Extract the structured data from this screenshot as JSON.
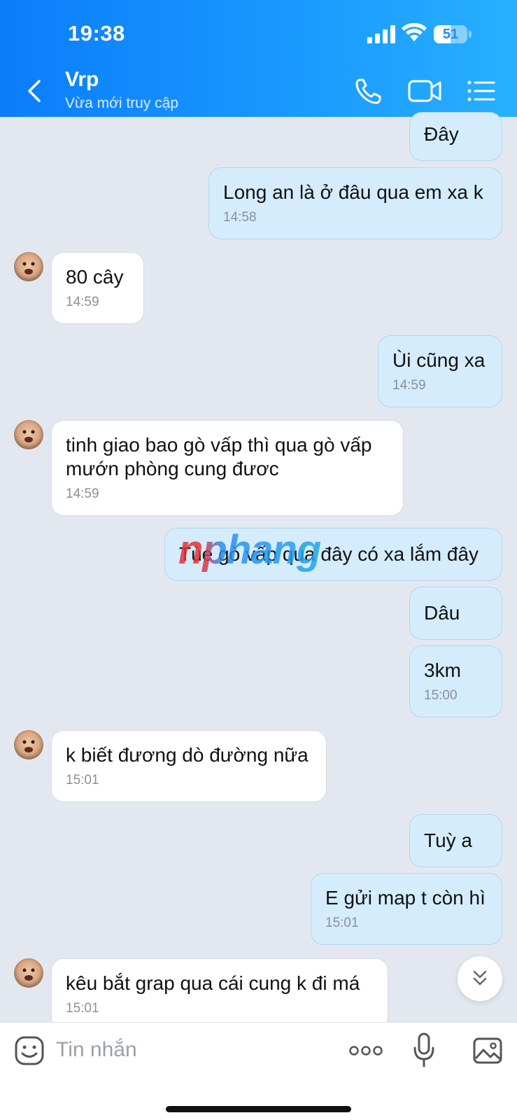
{
  "status_bar": {
    "time": "19:38",
    "battery": "51",
    "battery_level": 0.51
  },
  "header": {
    "contact_name": "Vrp",
    "contact_status": "Vừa mới truy cập"
  },
  "messages": [
    {
      "dir": "sent",
      "text": "Đây",
      "time": ""
    },
    {
      "dir": "sent",
      "text": "Long an là ở đâu qua em xa k",
      "time": "14:58"
    },
    {
      "dir": "recv",
      "text": "80 cây",
      "time": "14:59"
    },
    {
      "dir": "sent",
      "text": "Ùi cũng xa",
      "time": "14:59"
    },
    {
      "dir": "recv",
      "text": "tinh giao bao gò vấp thì qua gò vấp mướn phòng cung đươc",
      "time": "14:59"
    },
    {
      "dir": "sent",
      "text": "Tùe gò vấp qua đây có xa lắm đây",
      "time": ""
    },
    {
      "dir": "sent",
      "text": "Dâu",
      "time": ""
    },
    {
      "dir": "sent",
      "text": "3km",
      "time": "15:00"
    },
    {
      "dir": "recv",
      "text": "k biết đương dò đường nữa",
      "time": "15:01"
    },
    {
      "dir": "sent",
      "text": "Tuỳ a",
      "time": ""
    },
    {
      "dir": "sent",
      "text": "E gửi map t còn hì",
      "time": "15:01"
    },
    {
      "dir": "recv",
      "text": "kêu bắt grap qua cái cung k đi má",
      "time": "15:01"
    }
  ],
  "watermark": "nphang",
  "composer": {
    "placeholder": "Tin nhắn"
  },
  "colors": {
    "header_start": "#0b7dfa",
    "header_end": "#27b0ff",
    "sent_bubble": "#d4ecfc",
    "recv_bubble": "#ffffff",
    "background": "#e3e8f0"
  },
  "icons": [
    "back-icon",
    "phone-icon",
    "video-call-icon",
    "menu-list-icon",
    "emoji-icon",
    "more-dots-icon",
    "microphone-icon",
    "image-icon",
    "chevron-double-down-icon"
  ]
}
